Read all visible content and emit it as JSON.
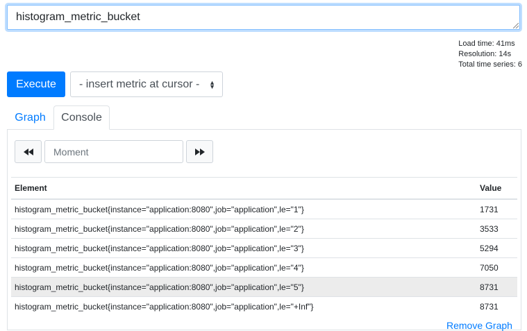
{
  "expression": {
    "value": "histogram_metric_bucket"
  },
  "stats": {
    "load_time": "Load time: 41ms",
    "resolution": "Resolution: 14s",
    "total_series": "Total time series: 6"
  },
  "actions": {
    "execute_label": "Execute",
    "insert_metric": "- insert metric at cursor -"
  },
  "tabs": [
    {
      "label": "Graph"
    },
    {
      "label": "Console"
    }
  ],
  "console": {
    "moment_placeholder": "Moment",
    "prev_icon": "double-left-arrow",
    "next_icon": "double-right-arrow"
  },
  "table": {
    "headers": {
      "element": "Element",
      "value": "Value"
    },
    "rows": [
      {
        "element": "histogram_metric_bucket{instance=\"application:8080\",job=\"application\",le=\"1\"}",
        "value": "1731"
      },
      {
        "element": "histogram_metric_bucket{instance=\"application:8080\",job=\"application\",le=\"2\"}",
        "value": "3533"
      },
      {
        "element": "histogram_metric_bucket{instance=\"application:8080\",job=\"application\",le=\"3\"}",
        "value": "5294"
      },
      {
        "element": "histogram_metric_bucket{instance=\"application:8080\",job=\"application\",le=\"4\"}",
        "value": "7050"
      },
      {
        "element": "histogram_metric_bucket{instance=\"application:8080\",job=\"application\",le=\"5\"}",
        "value": "8731"
      },
      {
        "element": "histogram_metric_bucket{instance=\"application:8080\",job=\"application\",le=\"+Inf\"}",
        "value": "8731"
      }
    ]
  },
  "footer": {
    "link_text": "Remove Graph"
  },
  "colors": {
    "primary": "#007bff",
    "highlight_row": "#ececec",
    "border": "#dee2e6"
  }
}
